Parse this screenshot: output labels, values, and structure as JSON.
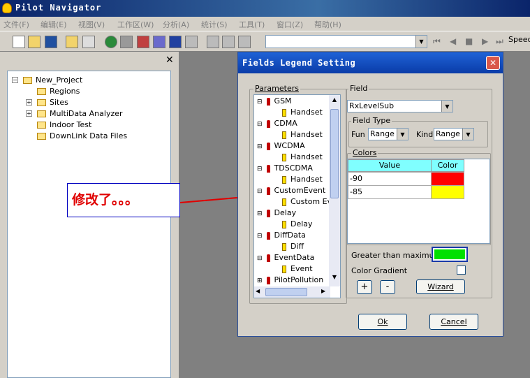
{
  "app": {
    "title": "Pilot Navigator"
  },
  "menu": [
    "文件(F)",
    "编辑(E)",
    "视图(V)",
    "工作区(W)",
    "分析(A)",
    "统计(S)",
    "工具(T)",
    "窗口(Z)",
    "帮助(H)"
  ],
  "toolbar": {
    "speed_label": "Speed"
  },
  "tree": {
    "root": "New_Project",
    "children": [
      "Regions",
      "Sites",
      "MultiData Analyzer",
      "Indoor Test",
      "DownLink Data Files"
    ]
  },
  "annotation": {
    "text": "修改了。。。"
  },
  "dialog": {
    "title": "Fields Legend Setting",
    "parameters_label": "Parameters",
    "params": [
      {
        "name": "GSM",
        "child": "Handset"
      },
      {
        "name": "CDMA",
        "child": "Handset"
      },
      {
        "name": "WCDMA",
        "child": "Handset"
      },
      {
        "name": "TDSCDMA",
        "child": "Handset"
      },
      {
        "name": "CustomEvent",
        "child": "Custom Ev"
      },
      {
        "name": "Delay",
        "child": "Delay"
      },
      {
        "name": "DiffData",
        "child": "Diff"
      },
      {
        "name": "EventData",
        "child": "Event"
      },
      {
        "name": "PilotPollution",
        "child": ""
      }
    ],
    "field_label": "Field",
    "field_value": "RxLevelSub",
    "field_type_label": "Field Type",
    "fun_label": "Fun",
    "fun_value": "Range",
    "kind_label": "Kind",
    "kind_value": "Range",
    "colors_label": "Colors",
    "table_headers": [
      "Value",
      "Color"
    ],
    "rows": [
      {
        "value": "-90",
        "color": "#ff0000"
      },
      {
        "value": "-85",
        "color": "#ffff00"
      }
    ],
    "greater_than_max_label": "Greater than maximum:",
    "greater_color": "#00e000",
    "color_gradient_label": "Color Gradient",
    "plus_label": "+",
    "minus_label": "-",
    "wizard_label": "Wizard",
    "ok_label": "Ok",
    "cancel_label": "Cancel"
  }
}
